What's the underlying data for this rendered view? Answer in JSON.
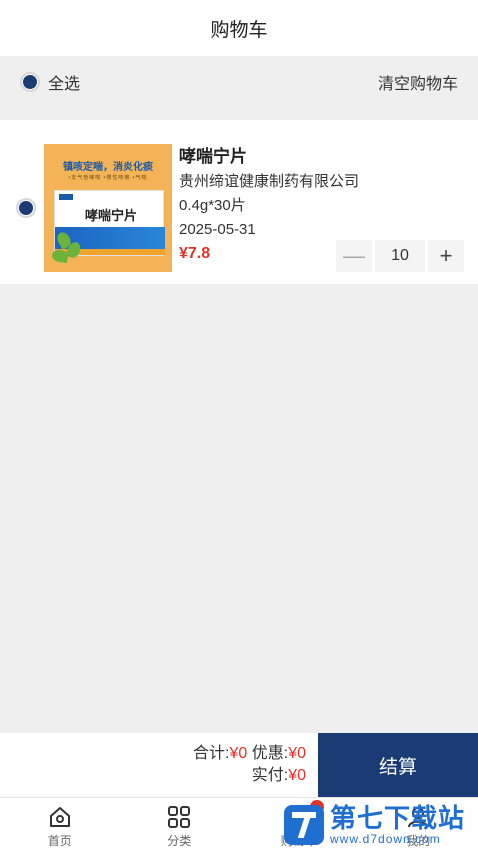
{
  "header": {
    "title": "购物车"
  },
  "select_bar": {
    "select_all_label": "全选",
    "clear_label": "清空购物车"
  },
  "cart": {
    "items": [
      {
        "name": "哮喘宁片",
        "manufacturer": "贵州缔谊健康制药有限公司",
        "spec": "0.4g*30片",
        "date": "2025-05-31",
        "price": "¥7.8",
        "quantity": "10",
        "selected": true,
        "image": {
          "tagline": "镇咳定喘，消炎化痰",
          "subtags": "•支气管哮喘 •慢性咳嗽 •气喘",
          "box_name": "哮喘宁片"
        }
      }
    ]
  },
  "stepper": {
    "minus": "—",
    "plus": "+"
  },
  "footer": {
    "total_label": "合计:",
    "total_value": "¥0",
    "discount_label": "优惠:",
    "discount_value": "¥0",
    "paid_label": "实付:",
    "paid_value": "¥0",
    "checkout_label": "结算"
  },
  "tabbar": {
    "tabs": [
      {
        "label": "首页",
        "icon": "home-icon"
      },
      {
        "label": "分类",
        "icon": "category-icon"
      },
      {
        "label": "购物车",
        "icon": "cart-icon"
      },
      {
        "label": "我的",
        "icon": "user-icon"
      }
    ]
  },
  "watermark": {
    "name": "第七下载站",
    "url": "www.d7down.com"
  },
  "colors": {
    "accent": "#1b3b75",
    "price": "#e0322b",
    "background": "#efefef"
  }
}
